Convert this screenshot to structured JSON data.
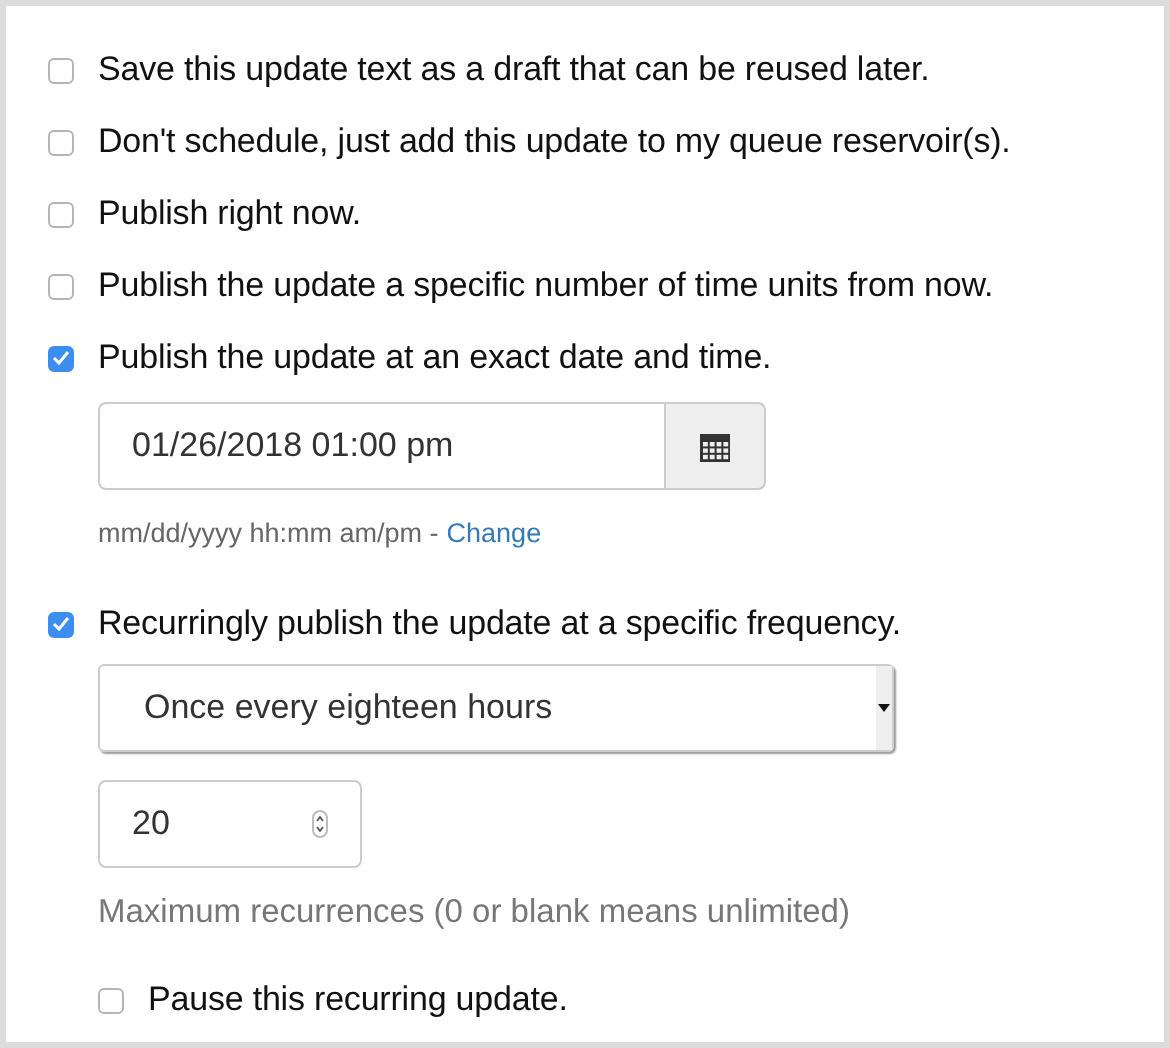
{
  "options": [
    {
      "label": "Save this update text as a draft that can be reused later.",
      "checked": false
    },
    {
      "label": "Don't schedule, just add this update to my queue reservoir(s).",
      "checked": false
    },
    {
      "label": "Publish right now.",
      "checked": false
    },
    {
      "label": "Publish the update a specific number of time units from now.",
      "checked": false
    },
    {
      "label": "Publish the update at an exact date and time.",
      "checked": true
    },
    {
      "label": "Recurringly publish the update at a specific frequency.",
      "checked": true
    }
  ],
  "schedule": {
    "value": "01/26/2018 01:00 pm",
    "format_hint": "mm/dd/yyyy hh:mm am/pm -",
    "change_link": "Change"
  },
  "recurrence": {
    "frequency": "Once every eighteen hours",
    "max_value": "20",
    "max_hint": "Maximum recurrences (0 or blank means unlimited)",
    "pause": {
      "label": "Pause this recurring update.",
      "checked": false
    }
  }
}
